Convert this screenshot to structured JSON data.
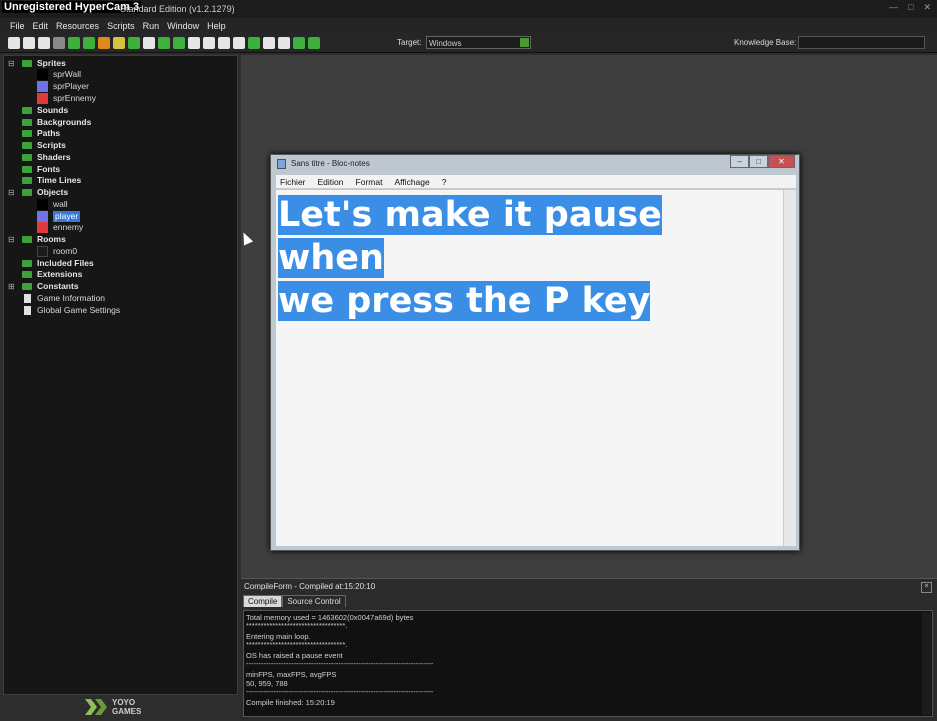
{
  "window": {
    "watermark": "Unregistered HyperCam 3",
    "title": "Standard Edition (v1.2.1279)",
    "controls": [
      "—",
      "□",
      "✕"
    ]
  },
  "menu": [
    "File",
    "Edit",
    "Resources",
    "Scripts",
    "Run",
    "Window",
    "Help"
  ],
  "toolbar": {
    "target_label": "Target:",
    "target_value": "Windows",
    "knowledge_label": "Knowledge Base:"
  },
  "tree": {
    "sprites": "Sprites",
    "sprite_items": [
      "sprWall",
      "sprPlayer",
      "sprEnnemy"
    ],
    "sounds": "Sounds",
    "backgrounds": "Backgrounds",
    "paths": "Paths",
    "scripts": "Scripts",
    "shaders": "Shaders",
    "fonts": "Fonts",
    "timelines": "Time Lines",
    "objects": "Objects",
    "object_items": [
      "wall",
      "player",
      "ennemy"
    ],
    "rooms": "Rooms",
    "room_items": [
      "room0"
    ],
    "included_files": "Included Files",
    "extensions": "Extensions",
    "constants": "Constants",
    "game_information": "Game Information",
    "global_settings": "Global Game Settings",
    "colors": {
      "black": "#000000",
      "blue": "#7272e8",
      "red": "#e03a3a"
    }
  },
  "logo": {
    "line1": "YOYO",
    "line2": "GAMES"
  },
  "notepad": {
    "title": "Sans titre - Bloc-notes",
    "menu": [
      "Fichier",
      "Edition",
      "Format",
      "Affichage",
      "?"
    ],
    "text_line1": "Let's make it pause when",
    "text_line2": "we press the P key",
    "highlight_color": "#3a8ee6"
  },
  "compile": {
    "title": "CompileForm - Compiled at:15:20:10",
    "tabs": [
      "Compile",
      "Source Control"
    ],
    "lines": [
      "Total memory used = 1463602(0x0047a69d) bytes",
      "**********************************.",
      "Entering main loop.",
      "**********************************.",
      "OS has raised a pause event",
      "---------------------------------------------------------------------------",
      "minFPS, maxFPS, avgFPS",
      "50, 959, 788",
      "---------------------------------------------------------------------------",
      "Compile finished: 15:20:19"
    ]
  }
}
